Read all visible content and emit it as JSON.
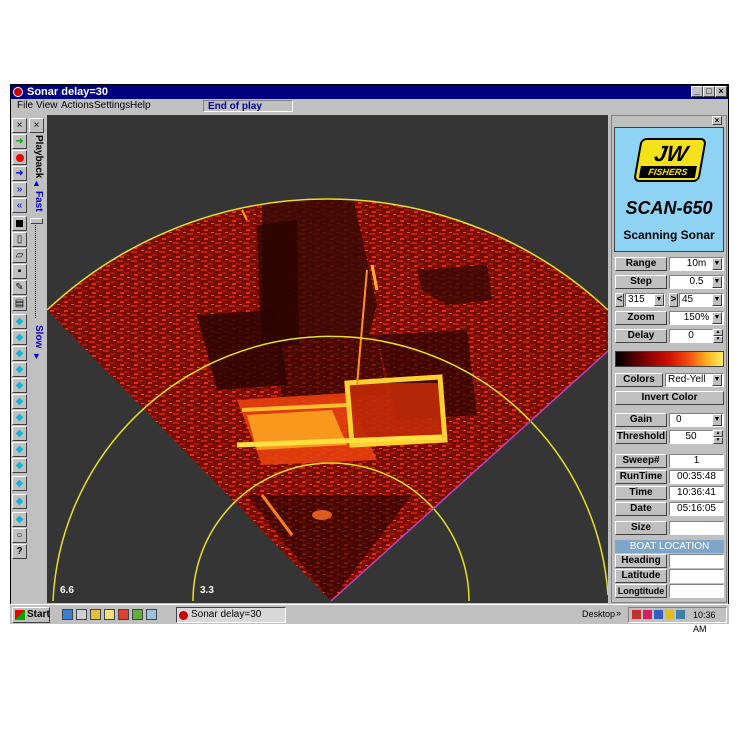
{
  "window": {
    "title": "Sonar delay=30"
  },
  "menu": {
    "items": [
      "File",
      "View",
      "Actions",
      "Settings",
      "Help"
    ],
    "status": "End of play"
  },
  "playback": {
    "label": "Playback",
    "fast": "Fast",
    "slow": "Slow"
  },
  "sonar": {
    "range_labels": [
      "6.6",
      "3.3"
    ]
  },
  "panel": {
    "logo_top": "JW",
    "logo_bottom": "FISHERS",
    "product": "SCAN-650",
    "subtitle": "Scanning Sonar",
    "range_label": "Range",
    "range_value": "10m",
    "step_label": "Step",
    "step_value": "0.5",
    "left_angle_symbol": "<",
    "left_angle": "315",
    "right_angle_symbol": ">",
    "right_angle": "45",
    "zoom_label": "Zoom",
    "zoom_value": "150%",
    "delay_label": "Delay",
    "delay_value": "0",
    "colors_label": "Colors",
    "colors_value": "Red-Yell",
    "invert_label": "Invert Color",
    "gain_label": "Gain",
    "gain_value": "0",
    "threshold_label": "Threshold",
    "threshold_value": "50",
    "sweep_label": "Sweep#",
    "sweep_value": "1",
    "runtime_label": "RunTime",
    "runtime_value": "00:35:48",
    "time_label": "Time",
    "time_value": "10:36:41",
    "date_label": "Date",
    "date_value": "05:16:05",
    "size_label": "Size",
    "size_value": "",
    "boat_header": "BOAT LOCATION",
    "heading_label": "Heading",
    "heading_value": "",
    "latitude_label": "Latitude",
    "latitude_value": "",
    "longitude_label": "Longtitude",
    "longitude_value": ""
  },
  "taskbar": {
    "start": "Start",
    "app": "Sonar delay=30",
    "desktop": "Desktop",
    "clock": "10:36 AM"
  }
}
